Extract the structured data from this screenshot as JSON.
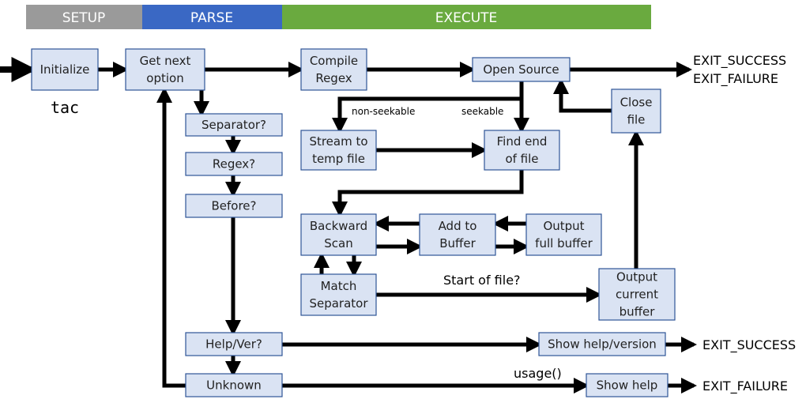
{
  "phases": [
    {
      "label": "SETUP",
      "color": "#9a9a9a"
    },
    {
      "label": "PARSE",
      "color": "#3a68c4"
    },
    {
      "label": "EXECUTE",
      "color": "#6aaa3f"
    }
  ],
  "program_name": "tac",
  "nodes": {
    "initialize": [
      "Initialize"
    ],
    "get_next_option": [
      "Get next",
      "option"
    ],
    "separator": [
      "Separator?"
    ],
    "regex": [
      "Regex?"
    ],
    "before": [
      "Before?"
    ],
    "help_ver": [
      "Help/Ver?"
    ],
    "unknown": [
      "Unknown"
    ],
    "compile_regex": [
      "Compile",
      "Regex"
    ],
    "open_source": [
      "Open Source"
    ],
    "stream_to_temp": [
      "Stream to",
      "temp file"
    ],
    "find_end": [
      "Find end",
      "of file"
    ],
    "close_file": [
      "Close",
      "file"
    ],
    "backward_scan": [
      "Backward",
      "Scan"
    ],
    "add_to_buffer": [
      "Add to",
      "Buffer"
    ],
    "output_full": [
      "Output",
      "full buffer"
    ],
    "match_separator": [
      "Match",
      "Separator"
    ],
    "output_current": [
      "Output",
      "current",
      "buffer"
    ],
    "show_help_version": [
      "Show help/version"
    ],
    "show_help": [
      "Show help"
    ]
  },
  "edge_labels": {
    "non_seekable": "non-seekable",
    "seekable": "seekable",
    "start_of_file": "Start of file?",
    "usage": "usage()"
  },
  "exits": {
    "main_success": "EXIT_SUCCESS",
    "main_failure": "EXIT_FAILURE",
    "help_success": "EXIT_SUCCESS",
    "usage_failure": "EXIT_FAILURE"
  },
  "colors": {
    "box_fill": "#dae3f3",
    "box_stroke": "#2f5597",
    "arrow": "#000000"
  }
}
